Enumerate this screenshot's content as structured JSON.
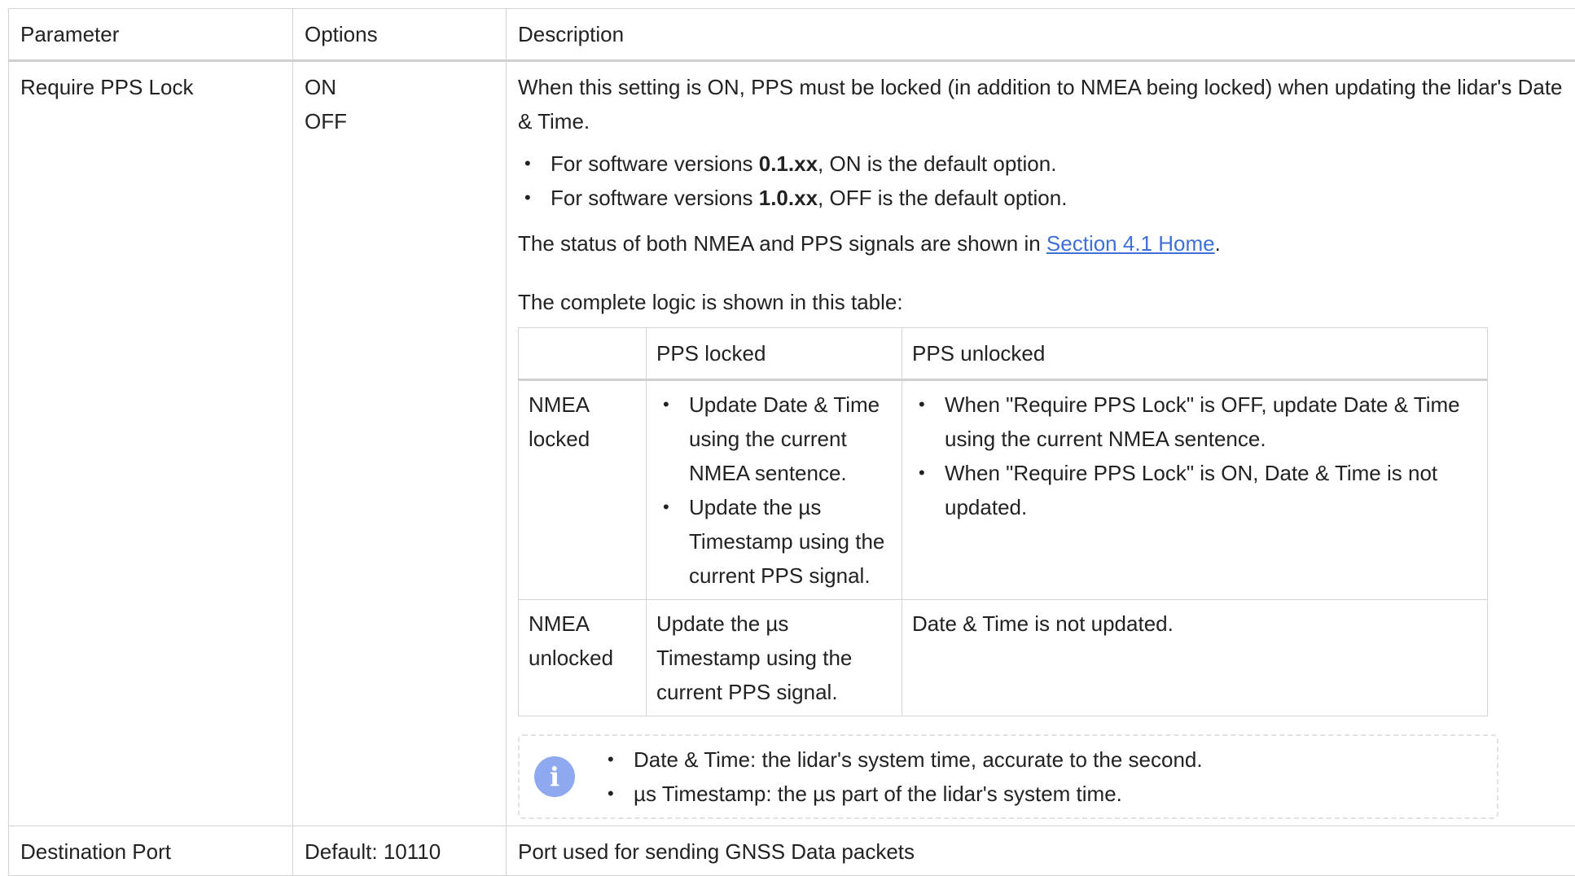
{
  "table": {
    "headers": [
      "Parameter",
      "Options",
      "Description"
    ],
    "rows": [
      {
        "parameter": "Require PPS Lock",
        "options": [
          "ON",
          "OFF"
        ],
        "description": {
          "intro": "When this setting is ON, PPS must be locked (in addition to NMEA being locked) when updating the lidar's Date & Time.",
          "bullets": [
            {
              "prefix": "For software versions ",
              "bold": "0.1.xx",
              "suffix": ", ON is the default option."
            },
            {
              "prefix": "For software versions ",
              "bold": "1.0.xx",
              "suffix": ", OFF is the default option."
            }
          ],
          "status_prefix": "The status of both NMEA and PPS signals are shown in ",
          "status_link": "Section 4.1 Home",
          "status_suffix": ".",
          "logic_intro": "The complete logic is shown in this table:",
          "logic_table": {
            "headers": [
              "",
              "PPS locked",
              "PPS unlocked"
            ],
            "rows": [
              {
                "label": "NMEA locked",
                "pps_locked": [
                  "Update Date & Time using the current NMEA sentence.",
                  "Update the µs Timestamp using the current PPS signal."
                ],
                "pps_unlocked": [
                  "When \"Require PPS Lock\" is OFF, update Date & Time using the current NMEA sentence.",
                  "When \"Require PPS Lock\" is ON, Date & Time is not updated."
                ]
              },
              {
                "label": "NMEA unlocked",
                "pps_locked": "Update the µs Timestamp using the current PPS signal.",
                "pps_unlocked": "Date & Time is not updated."
              }
            ]
          },
          "note": {
            "icon": "info-icon",
            "items": [
              "Date & Time: the lidar's system time, accurate to the second.",
              "µs Timestamp: the µs part of the lidar's system time."
            ]
          }
        }
      },
      {
        "parameter": "Destination Port",
        "options": "Default: 10110",
        "description": "Port used for sending GNSS Data packets"
      }
    ]
  },
  "colors": {
    "link": "#3f6fd9",
    "border": "#d4d4d4",
    "info_icon": "#8fa9f0"
  }
}
